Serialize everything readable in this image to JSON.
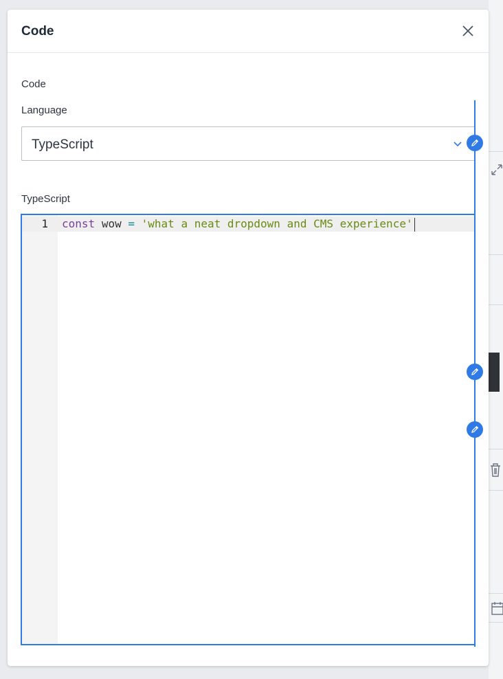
{
  "modal": {
    "title": "Code",
    "close_icon": "close-icon"
  },
  "form": {
    "section_label": "Code",
    "language_label": "Language",
    "language_value": "TypeScript",
    "editor_label": "TypeScript"
  },
  "editor": {
    "line_numbers": [
      "1"
    ],
    "tokens": {
      "kw": "const",
      "name": "wow",
      "op": "=",
      "str": "'what a neat dropdown and CMS experience'"
    }
  },
  "colors": {
    "accent": "#2f7ae5",
    "keyword": "#7a3e9d",
    "string": "#6a8a12",
    "operator": "#0e8a8a"
  },
  "edit_handles": [
    "pencil-icon",
    "pencil-icon",
    "pencil-icon"
  ]
}
